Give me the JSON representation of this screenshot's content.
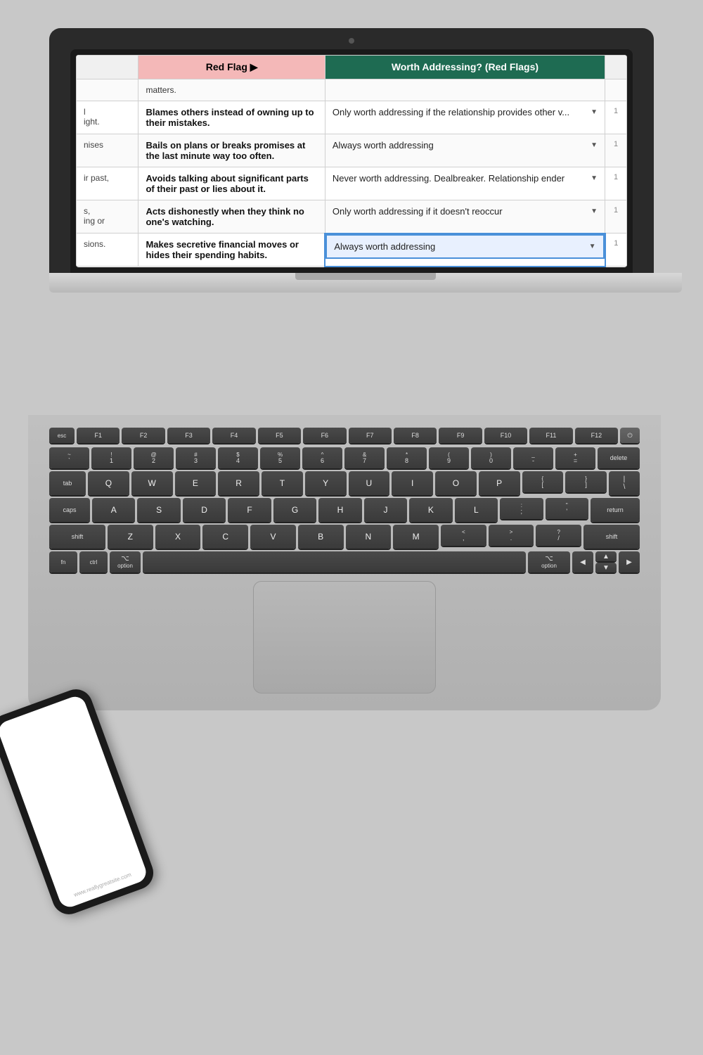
{
  "spreadsheet": {
    "col_header_redflag": "Red Flag ▶",
    "col_header_worth": "Worth Addressing? (Red Flags)",
    "top_row_stub": "matters.",
    "rows": [
      {
        "id": 1,
        "left_stub": "l\night.",
        "redflag": "Blames others instead of owning up to their mistakes.",
        "worth": "Only worth addressing if the relationship provides other v...",
        "selected": false,
        "right_num": "1"
      },
      {
        "id": 2,
        "left_stub": "nises",
        "redflag": "Bails on plans or breaks promises at the last minute way too often.",
        "worth": "Always worth addressing",
        "selected": false,
        "right_num": "1"
      },
      {
        "id": 3,
        "left_stub": "ir past,",
        "redflag": "Avoids talking about significant parts of their past or lies about it.",
        "worth": "Never worth addressing. Dealbreaker. Relationship ender",
        "selected": false,
        "right_num": "1"
      },
      {
        "id": 4,
        "left_stub": "s,\ning or",
        "redflag": "Acts dishonestly when they think no one's watching.",
        "worth": "Only worth addressing if it doesn't reoccur",
        "selected": false,
        "right_num": "1"
      },
      {
        "id": 5,
        "left_stub": "sions.",
        "redflag": "Makes secretive financial moves or hides their spending habits.",
        "worth": "Always worth addressing",
        "selected": true,
        "right_num": "1"
      }
    ]
  },
  "keyboard": {
    "fn_keys": [
      "esc",
      "F1",
      "F2",
      "F3",
      "F4",
      "F5",
      "F6",
      "F7",
      "F8",
      "F9",
      "F10",
      "F11",
      "F12"
    ],
    "num_keys": [
      {
        "sym": "~",
        "num": "`"
      },
      {
        "sym": "!",
        "num": "1"
      },
      {
        "sym": "@",
        "num": "2"
      },
      {
        "sym": "#",
        "num": "3"
      },
      {
        "sym": "$",
        "num": "4"
      },
      {
        "sym": "%",
        "num": "5"
      },
      {
        "sym": "^",
        "num": "6"
      },
      {
        "sym": "&",
        "num": "7"
      },
      {
        "sym": "*",
        "num": "8"
      },
      {
        "sym": "(",
        "num": "9"
      },
      {
        "sym": ")",
        "num": "0"
      },
      {
        "sym": "_",
        "num": "-"
      },
      {
        "sym": "+",
        "num": "="
      }
    ],
    "qwerty": [
      "Q",
      "W",
      "E",
      "R",
      "T",
      "Y",
      "U",
      "I",
      "O",
      "P"
    ],
    "asdf": [
      "A",
      "S",
      "D",
      "F",
      "G",
      "H",
      "J",
      "K",
      "L"
    ],
    "zxcv": [
      "Z",
      "X",
      "C",
      "V",
      "B",
      "N",
      "M"
    ],
    "delete_label": "delete",
    "tab_label": "tab",
    "return_label": "return",
    "caps_label": "caps",
    "shift_label": "shift",
    "fn_label": "fn",
    "option_label": "option",
    "option_sym": "⌥"
  },
  "phone": {
    "url": "www.reallygreatsite.com"
  },
  "background_color": "#c8c8c8"
}
